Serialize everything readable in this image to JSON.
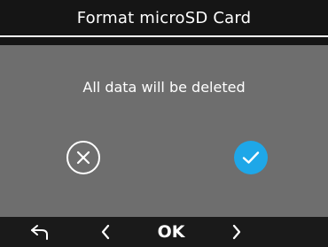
{
  "header": {
    "title": "Format microSD Card"
  },
  "dialog": {
    "message": "All data will be deleted",
    "cancel_icon": "cancel-x-icon",
    "confirm_icon": "checkmark-icon",
    "accent_color": "#1ea7e8"
  },
  "footer": {
    "back_icon": "back-arrow-icon",
    "prev_icon": "chevron-left-icon",
    "ok_label": "OK",
    "next_icon": "chevron-right-icon"
  }
}
